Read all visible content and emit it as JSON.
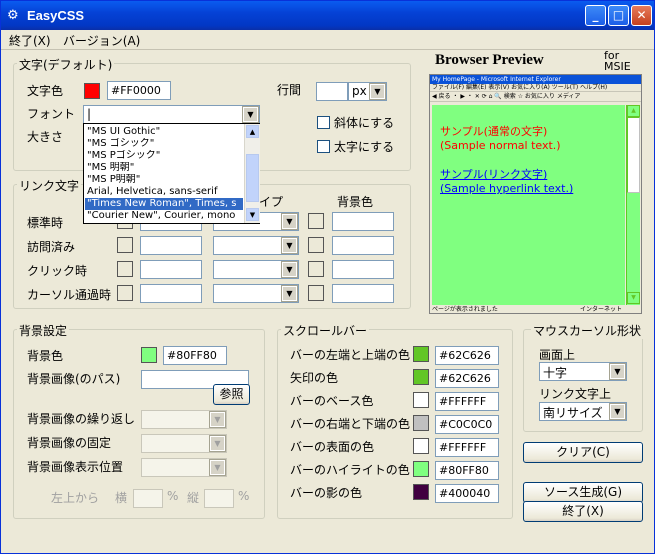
{
  "window": {
    "title": "EasyCSS",
    "min": "_",
    "max": "□",
    "close": "✕"
  },
  "menu": {
    "quit": "終了(X)",
    "version": "バージョン(A)"
  },
  "text_default": {
    "legend": "文字(デフォルト)",
    "color_label": "文字色",
    "color_value": "#FF0000",
    "color_swatch": "#ff0000",
    "font_label": "フォント",
    "font_value": "|",
    "size_label": "大きさ",
    "line_label": "行間",
    "line_unit": "px",
    "italic_label": "斜体にする",
    "bold_label": "太字にする"
  },
  "font_dropdown": {
    "items": [
      "\"MS UI Gothic\"",
      "\"MS ゴシック\"",
      "\"MS Pゴシック\"",
      "\"MS 明朝\"",
      "\"MS P明朝\"",
      "Arial, Helvetica, sans-serif",
      "\"Times New Roman\", Times, s",
      "\"Courier New\", Courier, mono"
    ],
    "selected_index": 6
  },
  "link_text": {
    "legend": "リンク文字",
    "style_header": "イプ",
    "bg_header": "背景色",
    "rows": [
      "標準時",
      "訪問済み",
      "クリック時",
      "カーソル通過時"
    ]
  },
  "background": {
    "legend": "背景設定",
    "color_label": "背景色",
    "color_value": "#80FF80",
    "color_swatch": "#80ff80",
    "image_label": "背景画像(のパス)",
    "browse": "参照",
    "repeat_label": "背景画像の繰り返し",
    "fixed_label": "背景画像の固定",
    "position_label": "背景画像表示位置",
    "from_top_left": "左上から",
    "horiz": "横",
    "vert": "縦",
    "percent": "%"
  },
  "scrollbar": {
    "legend": "スクロールバー",
    "rows": [
      {
        "label": "バーの左端と上端の色",
        "value": "#62C626",
        "swatch": "#62c626"
      },
      {
        "label": "矢印の色",
        "value": "#62C626",
        "swatch": "#62c626"
      },
      {
        "label": "バーのベース色",
        "value": "#FFFFFF",
        "swatch": "#ffffff"
      },
      {
        "label": "バーの右端と下端の色",
        "value": "#C0C0C0",
        "swatch": "#c0c0c0"
      },
      {
        "label": "バーの表面の色",
        "value": "#FFFFFF",
        "swatch": "#ffffff"
      },
      {
        "label": "バーのハイライトの色",
        "value": "#80FF80",
        "swatch": "#80ff80"
      },
      {
        "label": "バーの影の色",
        "value": "#400040",
        "swatch": "#400040"
      }
    ]
  },
  "cursor": {
    "legend": "マウスカーソル形状",
    "screen_label": "画面上",
    "screen_value": "十字",
    "link_label": "リンク文字上",
    "link_value": "南リサイズ"
  },
  "buttons": {
    "clear": "クリア(C)",
    "generate": "ソース生成(G)",
    "quit": "終了(X)"
  },
  "preview": {
    "title": "Browser Preview",
    "for_label": "for\nMSIE",
    "ie_title": "My HomePage - Microsoft Internet Explorer",
    "ie_menu": "ファイル(F)  編集(E)  表示(V)  お気に入り(A)  ツール(T)  ヘルプ(H)",
    "ie_toolbar": "◀ 戻る ・ ▶ ・ ✕  ⟳  ⌂   🔍 検索   ☆ お気に入り   メディア",
    "normal_text": "サンプル(通常の文字)",
    "normal_text_en": "(Sample normal text.)",
    "link_text": "サンプル(リンク文字)",
    "link_text_en": "(Sample hyperlink text.)",
    "status_left": "ページが表示されました",
    "status_right": "インターネット",
    "text_color": "#ff0000",
    "link_color": "#0000ff",
    "bg_color": "#80ff80"
  }
}
